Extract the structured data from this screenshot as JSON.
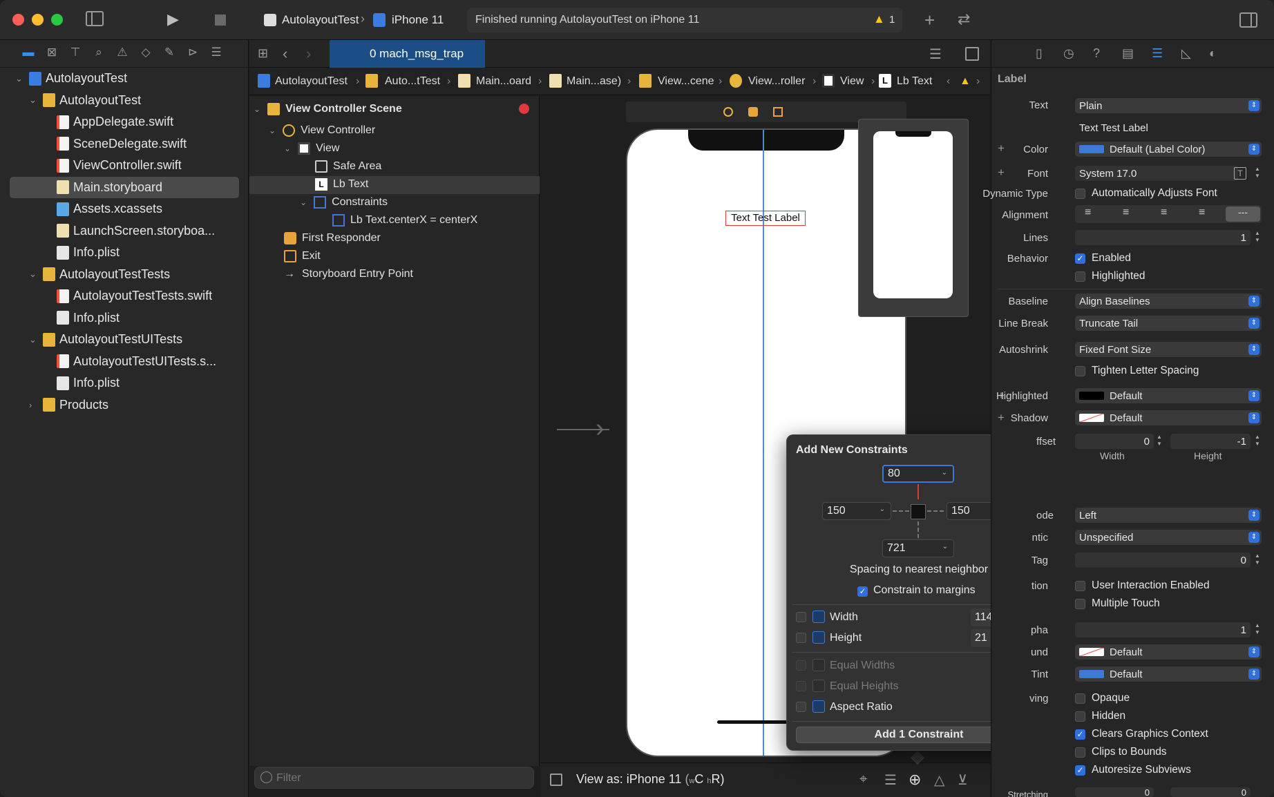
{
  "toolbar": {
    "scheme": "AutolayoutTest",
    "device": "iPhone 11",
    "status": "Finished running AutolayoutTest on iPhone 11",
    "warning_count": "1"
  },
  "navigator": {
    "items": [
      {
        "label": "AutolayoutTest"
      },
      {
        "label": "AutolayoutTest"
      },
      {
        "label": "AppDelegate.swift"
      },
      {
        "label": "SceneDelegate.swift"
      },
      {
        "label": "ViewController.swift"
      },
      {
        "label": "Main.storyboard"
      },
      {
        "label": "Assets.xcassets"
      },
      {
        "label": "LaunchScreen.storyboa..."
      },
      {
        "label": "Info.plist"
      },
      {
        "label": "AutolayoutTestTests"
      },
      {
        "label": "AutolayoutTestTests.swift"
      },
      {
        "label": "Info.plist"
      },
      {
        "label": "AutolayoutTestUITests"
      },
      {
        "label": "AutolayoutTestUITests.s..."
      },
      {
        "label": "Info.plist"
      },
      {
        "label": "Products"
      }
    ],
    "filter_placeholder": "Filter"
  },
  "editor": {
    "tab": "0 mach_msg_trap",
    "breadcrumbs": [
      "AutolayoutTest",
      "Auto...tTest",
      "Main...oard",
      "Main...ase)",
      "View...cene",
      "View...roller",
      "View",
      "Lb Text"
    ],
    "outline": {
      "scene": "View Controller Scene",
      "view_controller": "View Controller",
      "view": "View",
      "safe_area": "Safe Area",
      "lb_text": "Lb Text",
      "constraints": "Constraints",
      "constraint_item": "Lb Text.centerX = centerX",
      "first_responder": "First Responder",
      "exit": "Exit",
      "entry_point": "Storyboard Entry Point"
    },
    "canvas_label": "Text Test Label",
    "view_as_prefix": "View as: iPhone 11",
    "view_as_w": "w",
    "view_as_c": "C",
    "view_as_h": "h",
    "view_as_r": "R",
    "view_as_close": ")",
    "view_as_open": "("
  },
  "popover": {
    "title": "Add New Constraints",
    "top": "80",
    "left": "150",
    "right": "150",
    "bottom": "721",
    "spacing_label": "Spacing to nearest neighbor",
    "constrain_margins": "Constrain to margins",
    "width_label": "Width",
    "width_value": "114",
    "height_label": "Height",
    "height_value": "21",
    "equal_widths": "Equal Widths",
    "equal_heights": "Equal Heights",
    "aspect_ratio": "Aspect Ratio",
    "add_button": "Add 1 Constraint"
  },
  "inspector": {
    "section": "Label",
    "text_label": "Text",
    "text_type": "Plain",
    "text_value": "Text Test Label",
    "color_label": "Color",
    "color_value": "Default (Label Color)",
    "font_label": "Font",
    "font_value": "System 17.0",
    "dynamic_type_label": "Dynamic Type",
    "dynamic_type_value": "Automatically Adjusts Font",
    "alignment_label": "Alignment",
    "lines_label": "Lines",
    "lines_value": "1",
    "behavior_label": "Behavior",
    "enabled": "Enabled",
    "highlighted": "Highlighted",
    "baseline_label": "Baseline",
    "baseline_value": "Align Baselines",
    "line_break_label": "Line Break",
    "line_break_value": "Truncate Tail",
    "autoshrink_label": "Autoshrink",
    "autoshrink_value": "Fixed Font Size",
    "tighten": "Tighten Letter Spacing",
    "highlighted_label": "Highlighted",
    "highlighted_value": "Default",
    "shadow_label": "Shadow",
    "shadow_value": "Default",
    "offset_label": "ffset",
    "offset_width": "0",
    "offset_height": "-1",
    "width_caption": "Width",
    "height_caption": "Height",
    "mode_label": "ode",
    "mode_value": "Left",
    "semantic_label": "ntic",
    "semantic_value": "Unspecified",
    "tag_label": "Tag",
    "tag_value": "0",
    "interaction_label": "tion",
    "user_interaction": "User Interaction Enabled",
    "multiple_touch": "Multiple Touch",
    "alpha_label": "pha",
    "alpha_value": "1",
    "background_label": "und",
    "background_value": "Default",
    "tint_label": "Tint",
    "tint_value": "Default",
    "drawing_label": "ving",
    "opaque": "Opaque",
    "hidden": "Hidden",
    "clears_graphics": "Clears Graphics Context",
    "clips_bounds": "Clips to Bounds",
    "autoresize": "Autoresize Subviews",
    "stretching_label": "Stretching",
    "stretch_x": "0",
    "stretch_y": "0"
  },
  "colors": {
    "accent": "#2f6fde",
    "selection": "#1b4e86",
    "error": "#e03a3a",
    "warning": "#f5c518"
  }
}
